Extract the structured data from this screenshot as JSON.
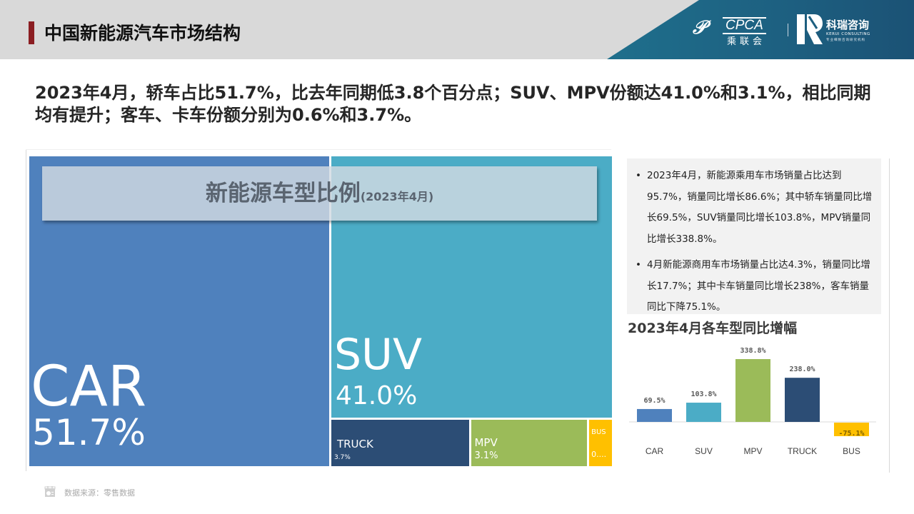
{
  "header": {
    "title": "中国新能源汽车市场结构",
    "logos": {
      "cpca": {
        "mark": "𝒫",
        "text": "CPCA",
        "cn": "乘联会",
        "sub": "CPCA"
      },
      "kerui": {
        "name": "科瑞咨询",
        "en": "KERUI CONSULTING",
        "tag": "专业细致咨询研究机构"
      }
    }
  },
  "headline": "2023年4月，轿车占比51.7%，比去年同期低3.8个百分点；SUV、MPV份额达41.0%和3.1%，相比同期均有提升；客车、卡车份额分别为0.6%和3.7%。",
  "notes": [
    {
      "bullet": "•",
      "text": "2023年4月，新能源乘用车市场销量占比达到95.7%，销量同比增长86.6%；其中轿车销量同比增长69.5%，SUV销量同比增长103.8%，MPV销量同比增长338.8%。"
    },
    {
      "bullet": "•",
      "text": "4月新能源商用车市场销量占比达4.3%，销量同比增长17.7%；其中卡车销量同比增长238%，客车销量同比下降75.1%。"
    }
  ],
  "footer": {
    "icon": "calendar-chart-icon",
    "text": "数据来源：零售数据"
  },
  "chart_data": [
    {
      "type": "treemap",
      "title": "新能源车型比例",
      "subtitle": "(2023年4月)",
      "unit": "%",
      "items": [
        {
          "name": "CAR",
          "value": 51.7,
          "label": "51.7%",
          "color": "#4f81bd"
        },
        {
          "name": "SUV",
          "value": 41.0,
          "label": "41.0%",
          "color": "#4bacc6"
        },
        {
          "name": "TRUCK",
          "value": 3.7,
          "label": "3.7%",
          "color": "#2c4d75"
        },
        {
          "name": "MPV",
          "value": 3.1,
          "label": "3.1%",
          "color": "#9bbb59"
        },
        {
          "name": "BUS",
          "value": 0.6,
          "label": "0....",
          "color": "#ffc000"
        }
      ]
    },
    {
      "type": "bar",
      "title": "2023年4月各车型同比增幅",
      "categories": [
        "CAR",
        "SUV",
        "MPV",
        "TRUCK",
        "BUS"
      ],
      "values": [
        69.5,
        103.8,
        338.8,
        238.0,
        -75.1
      ],
      "data_labels": [
        "69.5%",
        "103.8%",
        "338.8%",
        "238.0%",
        "-75.1%"
      ],
      "colors": [
        "#4f81bd",
        "#4bacc6",
        "#9bbb59",
        "#2c4d75",
        "#ffc000"
      ],
      "xlabel": "",
      "ylabel": "",
      "ylim": [
        -80,
        340
      ],
      "grid": false,
      "legend": "none"
    }
  ]
}
